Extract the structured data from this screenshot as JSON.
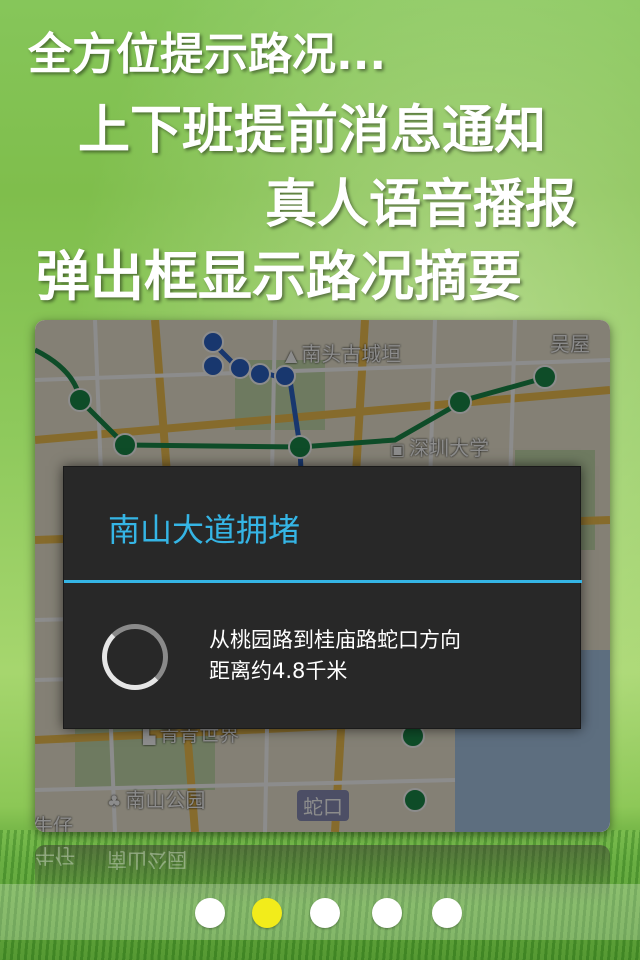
{
  "headlines": {
    "line1": "全方位提示路况...",
    "line2": "上下班提前消息通知",
    "line3": "真人语音播报",
    "line4": "弹出框显示路况摘要"
  },
  "map": {
    "labels": {
      "nantou": "南头古城垣",
      "wuwu": "吴屋",
      "szu": "深圳大学",
      "qingqing": "青青世界",
      "nanshan_park": "南山公园",
      "shekou": "蛇口",
      "niuzai": "牛仔"
    },
    "icons": {
      "castle": "castle-icon",
      "university": "university-icon",
      "park": "park-icon",
      "building": "building-icon"
    }
  },
  "dialog": {
    "title": "南山大道拥堵",
    "message_line1": "从桃园路到桂庙路蛇口方向",
    "message_line2": "距离约4.8千米",
    "accent_color": "#35b5e5"
  },
  "pager": {
    "count": 5,
    "active_index": 1,
    "active_color": "#f2ec1b",
    "inactive_color": "#ffffff"
  },
  "reflection": {
    "nanshan_park": "南山公园",
    "niuzai": "牛仔"
  }
}
